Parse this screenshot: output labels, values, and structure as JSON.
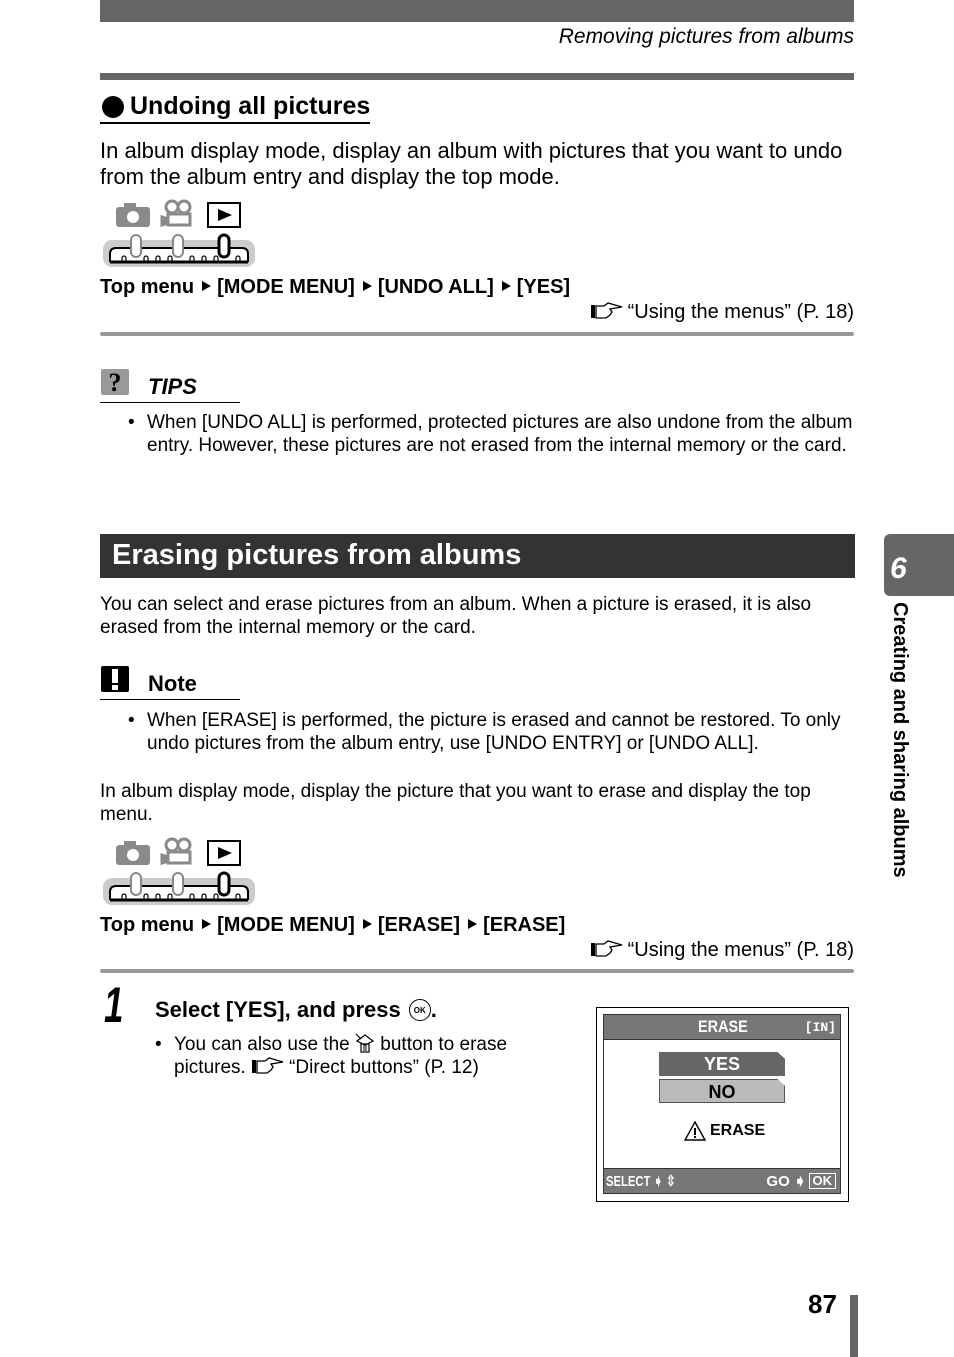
{
  "header": {
    "running_title": "Removing pictures from albums"
  },
  "undo_all": {
    "heading": "Undoing all pictures",
    "intro": "In album display mode, display an album with pictures that you want to undo from the album entry and display the top mode.",
    "mode_icons": [
      "camera-icon",
      "movie-icon",
      "playback-icon"
    ],
    "path": [
      "Top menu",
      "[MODE MENU]",
      "[UNDO ALL]",
      "[YES]"
    ],
    "reference": "“Using the menus” (P. 18)"
  },
  "tips": {
    "label": "TIPS",
    "items": [
      "When [UNDO ALL] is performed, protected pictures are also undone from the album entry. However, these pictures are not erased from the internal memory or the card."
    ]
  },
  "erase_section": {
    "title": "Erasing pictures from albums",
    "intro": "You can select and erase pictures from an album. When a picture is erased, it is also erased from the internal memory or the card.",
    "note_label": "Note",
    "note_items": [
      "When [ERASE] is performed, the picture is erased and cannot be restored. To only undo pictures from the album entry, use [UNDO ENTRY] or [UNDO ALL]."
    ],
    "instruction": "In album display mode, display the picture that you want to erase and display the top menu.",
    "path": [
      "Top menu",
      "[MODE MENU]",
      "[ERASE]",
      "[ERASE]"
    ],
    "reference": "“Using the menus” (P. 18)"
  },
  "step": {
    "number": "1",
    "title": "Select [YES], and press",
    "title_end": ".",
    "ok_label": "OK",
    "bullet_pre": "You can also use the",
    "bullet_post": "button to erase pictures.",
    "bullet_ref": "“Direct buttons” (P. 12)"
  },
  "lcd": {
    "title": "ERASE",
    "memory": "[IN]",
    "options": [
      "YES",
      "NO"
    ],
    "selected": "YES",
    "warning": "ERASE",
    "footer_left": "SELECT",
    "footer_right": "GO",
    "ok": "OK"
  },
  "side_tab": {
    "chapter": "6",
    "chapter_title": "Creating and sharing albums"
  },
  "page_number": "87"
}
